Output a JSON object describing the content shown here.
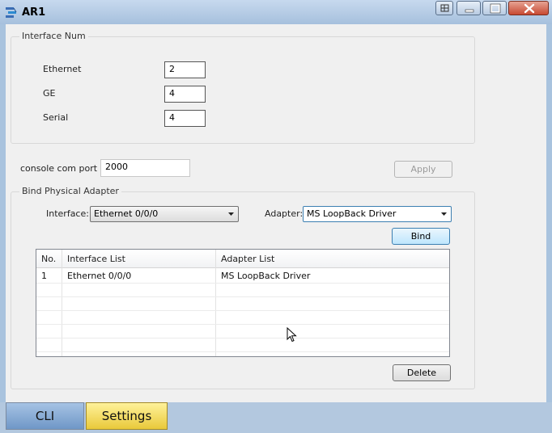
{
  "window": {
    "title": "AR1"
  },
  "interface_num": {
    "legend": "Interface Num",
    "ethernet": {
      "label": "Ethernet",
      "value": "2"
    },
    "ge": {
      "label": "GE",
      "value": "4"
    },
    "serial": {
      "label": "Serial",
      "value": "4"
    }
  },
  "console": {
    "label": "console com port",
    "value": "2000",
    "apply_label": "Apply"
  },
  "bind": {
    "legend": "Bind Physical Adapter",
    "interface_label": "Interface:",
    "interface_value": "Ethernet 0/0/0",
    "adapter_label": "Adapter:",
    "adapter_value": "MS LoopBack Driver",
    "bind_label": "Bind",
    "delete_label": "Delete",
    "table": {
      "headers": [
        "No.",
        "Interface List",
        "Adapter List"
      ],
      "rows": [
        {
          "no": "1",
          "interface": "Ethernet 0/0/0",
          "adapter": "MS LoopBack Driver"
        }
      ]
    }
  },
  "tabs": [
    {
      "label": "CLI"
    },
    {
      "label": "Settings"
    }
  ],
  "colors": {
    "titlebar": "#a6c0dd",
    "close": "#c84a32",
    "tab_active": "#e9c93a",
    "tab_inactive": "#6f97c7"
  },
  "icons": [
    "app-network-icon",
    "restore-icon",
    "minimize-icon",
    "maximize-icon",
    "close-icon",
    "chevron-down-icon",
    "mouse-pointer-icon"
  ]
}
